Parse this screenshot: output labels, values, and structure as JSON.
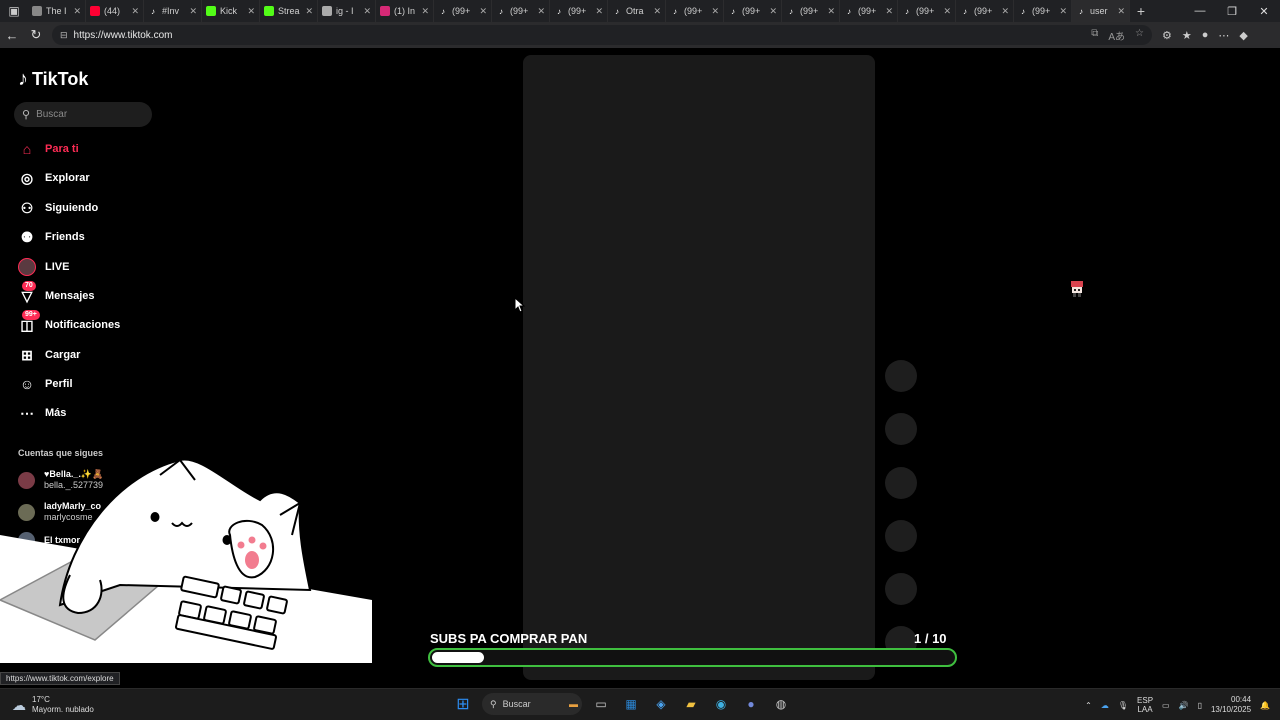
{
  "browser": {
    "tabs": [
      {
        "title": "The I",
        "icon": "globe-icon",
        "color": "#888888"
      },
      {
        "title": "(44)",
        "icon": "youtube-icon",
        "color": "#ff0033"
      },
      {
        "title": "#Inv",
        "icon": "tiktok-icon",
        "color": "#ffffff"
      },
      {
        "title": "Kick",
        "icon": "kick-icon",
        "color": "#53fc18"
      },
      {
        "title": "Strea",
        "icon": "kick-icon",
        "color": "#53fc18"
      },
      {
        "title": "ig - I",
        "icon": "search-icon",
        "color": "#aaaaaa"
      },
      {
        "title": "(1) In",
        "icon": "instagram-icon",
        "color": "#d62976"
      },
      {
        "title": "(99+",
        "icon": "tiktok-icon",
        "color": "#ffffff"
      },
      {
        "title": "(99+",
        "icon": "tiktok-icon",
        "color": "#ffffff"
      },
      {
        "title": "(99+",
        "icon": "tiktok-icon",
        "color": "#ffffff"
      },
      {
        "title": "Otra",
        "icon": "tiktok-icon",
        "color": "#ffffff"
      },
      {
        "title": "(99+",
        "icon": "tiktok-icon",
        "color": "#ffffff"
      },
      {
        "title": "(99+",
        "icon": "tiktok-icon",
        "color": "#ffffff"
      },
      {
        "title": "(99+",
        "icon": "tiktok-icon",
        "color": "#ffffff"
      },
      {
        "title": "(99+",
        "icon": "tiktok-icon",
        "color": "#ffffff"
      },
      {
        "title": "(99+",
        "icon": "tiktok-icon",
        "color": "#ffffff"
      },
      {
        "title": "(99+",
        "icon": "tiktok-icon",
        "color": "#ffffff"
      },
      {
        "title": "(99+",
        "icon": "tiktok-icon",
        "color": "#ffffff"
      },
      {
        "title": "user",
        "icon": "tiktok-icon",
        "color": "#ffffff",
        "active": true
      }
    ],
    "url": "https://www.tiktok.com"
  },
  "sidebar": {
    "logo": "TikTok",
    "search_placeholder": "Buscar",
    "nav": [
      {
        "label": "Para ti",
        "icon": "home-icon",
        "active": true
      },
      {
        "label": "Explorar",
        "icon": "compass-icon"
      },
      {
        "label": "Siguiendo",
        "icon": "following-icon"
      },
      {
        "label": "Friends",
        "icon": "friends-icon"
      },
      {
        "label": "LIVE",
        "icon": "live-avatar-icon"
      },
      {
        "label": "Mensajes",
        "icon": "messages-icon",
        "badge": "70"
      },
      {
        "label": "Notificaciones",
        "icon": "notifications-icon",
        "badge": "99+"
      },
      {
        "label": "Cargar",
        "icon": "upload-icon"
      },
      {
        "label": "Perfil",
        "icon": "profile-icon"
      },
      {
        "label": "Más",
        "icon": "more-icon"
      }
    ],
    "following_title": "Cuentas que sigues",
    "following": [
      {
        "name": "♥Bella._.✨🧸",
        "handle": "bella._.527739"
      },
      {
        "name": "ladyMarly_co",
        "handle": "marlycosme"
      },
      {
        "name": "El txmor",
        "handle": ""
      }
    ]
  },
  "overlay": {
    "goal_label": "SUBS PA COMPRAR PAN",
    "goal_count": "1  / 10",
    "goal_progress": 0.1,
    "goal_color": "#3fbf3f"
  },
  "status_url": "https://www.tiktok.com/explore",
  "taskbar": {
    "temperature": "17°C",
    "weather": "Mayorm. nublado",
    "search": "Buscar",
    "lang_line1": "ESP",
    "lang_line2": "LAA",
    "time": "00:44",
    "date": "13/10/2025"
  }
}
